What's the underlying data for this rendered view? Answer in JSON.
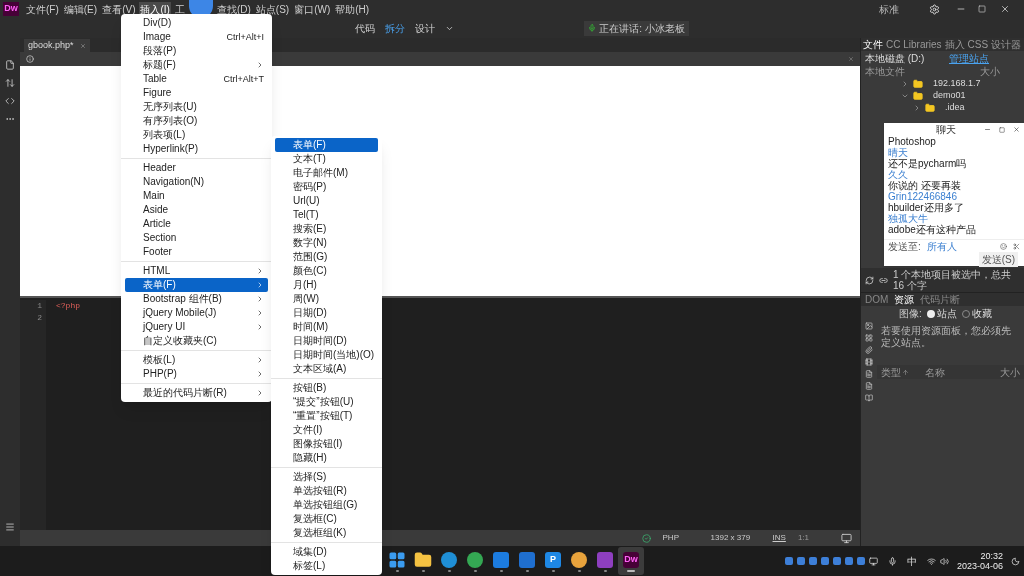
{
  "menu_bar": {
    "logo": "Dw",
    "items": [
      {
        "label": "文件(F)",
        "selected": false
      },
      {
        "label": "编辑(E)",
        "selected": false
      },
      {
        "label": "查看(V)",
        "selected": false
      },
      {
        "label": "插入(I)",
        "selected": true
      },
      {
        "label": "工",
        "selected": false
      },
      {
        "label": "查找(D)",
        "selected": false
      },
      {
        "label": "站点(S)",
        "selected": false
      },
      {
        "label": "窗口(W)",
        "selected": false
      },
      {
        "label": "帮助(H)",
        "selected": false
      }
    ]
  },
  "view_switch": [
    {
      "label": "代码",
      "selected": false
    },
    {
      "label": "拆分",
      "selected": true
    },
    {
      "label": "设计",
      "selected": false
    }
  ],
  "notification": "正在讲话: 小冰老板",
  "workspace": "标准",
  "document_tab": {
    "label": "gbook.php*"
  },
  "code_lines": [
    {
      "number": "1",
      "text": "<?php"
    },
    {
      "number": "2"
    }
  ],
  "status_bar": {
    "language": "PHP",
    "size": "1392 x 379",
    "mode": "INS",
    "position": "1:1"
  },
  "insert_menu": {
    "groups": [
      [
        {
          "label": "Div(D)",
          "submenu": false,
          "selected": false
        },
        {
          "label": "Image",
          "shortcut": "Ctrl+Alt+I",
          "submenu": false,
          "selected": false
        },
        {
          "label": "段落(P)",
          "submenu": false,
          "selected": false
        },
        {
          "label": "标题(F)",
          "submenu": true,
          "selected": false
        },
        {
          "label": "Table",
          "shortcut": "Ctrl+Alt+T",
          "submenu": false,
          "selected": false
        },
        {
          "label": "Figure",
          "submenu": false,
          "selected": false
        },
        {
          "label": "无序列表(U)",
          "submenu": false,
          "selected": false
        },
        {
          "label": "有序列表(O)",
          "submenu": false,
          "selected": false
        },
        {
          "label": "列表项(L)",
          "submenu": false,
          "selected": false
        },
        {
          "label": "Hyperlink(P)",
          "submenu": false,
          "selected": false
        }
      ],
      [
        {
          "label": "Header",
          "submenu": false,
          "selected": false
        },
        {
          "label": "Navigation(N)",
          "submenu": false,
          "selected": false
        },
        {
          "label": "Main",
          "submenu": false,
          "selected": false
        },
        {
          "label": "Aside",
          "submenu": false,
          "selected": false
        },
        {
          "label": "Article",
          "submenu": false,
          "selected": false
        },
        {
          "label": "Section",
          "submenu": false,
          "selected": false
        },
        {
          "label": "Footer",
          "submenu": false,
          "selected": false
        }
      ],
      [
        {
          "label": "HTML",
          "submenu": true,
          "selected": false
        },
        {
          "label": "表单(F)",
          "submenu": true,
          "selected": true
        },
        {
          "label": "Bootstrap 组件(B)",
          "submenu": true,
          "selected": false
        },
        {
          "label": "jQuery Mobile(J)",
          "submenu": true,
          "selected": false
        },
        {
          "label": "jQuery UI",
          "submenu": true,
          "selected": false
        },
        {
          "label": "自定义收藏夹(C)",
          "submenu": false,
          "selected": false
        }
      ],
      [
        {
          "label": "模板(L)",
          "submenu": true,
          "selected": false
        },
        {
          "label": "PHP(P)",
          "submenu": true,
          "selected": false
        }
      ],
      [
        {
          "label": "最近的代码片断(R)",
          "submenu": true,
          "selected": false
        }
      ]
    ]
  },
  "form_menu": {
    "groups": [
      [
        {
          "label": "表单(F)",
          "selected": true
        },
        {
          "label": "文本(T)",
          "selected": false
        },
        {
          "label": "电子邮件(M)",
          "selected": false
        },
        {
          "label": "密码(P)",
          "selected": false
        },
        {
          "label": "Url(U)",
          "selected": false
        },
        {
          "label": "Tel(T)",
          "selected": false
        },
        {
          "label": "搜索(E)",
          "selected": false
        },
        {
          "label": "数字(N)",
          "selected": false
        },
        {
          "label": "范围(G)",
          "selected": false
        },
        {
          "label": "颜色(C)",
          "selected": false
        },
        {
          "label": "月(H)",
          "selected": false
        },
        {
          "label": "周(W)",
          "selected": false
        },
        {
          "label": "日期(D)",
          "selected": false
        },
        {
          "label": "时间(M)",
          "selected": false
        },
        {
          "label": "日期时间(D)",
          "selected": false
        },
        {
          "label": "日期时间(当地)(O)",
          "selected": false
        },
        {
          "label": "文本区域(A)",
          "selected": false
        }
      ],
      [
        {
          "label": "按钮(B)",
          "selected": false
        },
        {
          "label": "“提交”按钮(U)",
          "selected": false
        },
        {
          "label": "“重置”按钮(T)",
          "selected": false
        },
        {
          "label": "文件(I)",
          "selected": false
        },
        {
          "label": "图像按钮(I)",
          "selected": false
        },
        {
          "label": "隐藏(H)",
          "selected": false
        }
      ],
      [
        {
          "label": "选择(S)",
          "selected": false
        },
        {
          "label": "单选按钮(R)",
          "selected": false
        },
        {
          "label": "单选按钮组(G)",
          "selected": false
        },
        {
          "label": "复选框(C)",
          "selected": false
        },
        {
          "label": "复选框组(K)",
          "selected": false
        }
      ],
      [
        {
          "label": "域集(D)",
          "selected": false
        },
        {
          "label": "标签(L)",
          "selected": false
        }
      ]
    ]
  },
  "files_panel": {
    "tabs": [
      {
        "label": "文件",
        "selected": true
      },
      {
        "label": "CC Libraries",
        "selected": false
      },
      {
        "label": "插入",
        "selected": false
      },
      {
        "label": "CSS 设计器",
        "selected": false
      }
    ],
    "drive": "本地磁盘 (D:)",
    "manage_link": "管理站点",
    "columns": [
      "本地文件",
      "大小"
    ],
    "tree": [
      {
        "label": "192.168.1.7",
        "expanded": false
      },
      {
        "label": "demo01",
        "expanded": true,
        "children": [
          {
            "label": ".idea",
            "expanded": false
          }
        ]
      }
    ],
    "status": "1 个本地项目被选中，总共 16 个字"
  },
  "chat_window": {
    "title": "聊天",
    "messages": [
      {
        "text": "Photoshop",
        "kind": "message"
      },
      {
        "text": "晴天",
        "kind": "name"
      },
      {
        "text": "还不是pycharm吗",
        "kind": "message"
      },
      {
        "text": "久久",
        "kind": "name"
      },
      {
        "text": "你说的 还要再装",
        "kind": "message"
      },
      {
        "text": "Grin122466846",
        "kind": "name"
      },
      {
        "text": "hbuilder还用多了",
        "kind": "message"
      },
      {
        "text": "独孤大牛",
        "kind": "name"
      },
      {
        "text": "adobe还有这种产品",
        "kind": "message"
      }
    ],
    "send_to_label": "发送至:",
    "recipient": "所有人",
    "send_button": "发送(S)"
  },
  "assets_panel": {
    "tabs": [
      {
        "label": "DOM",
        "selected": false
      },
      {
        "label": "资源",
        "selected": true
      },
      {
        "label": "代码片断",
        "selected": false
      }
    ],
    "filter_label": "图像:",
    "filters": [
      {
        "label": "站点",
        "selected": true
      },
      {
        "label": "收藏",
        "selected": false
      }
    ],
    "message": "若要使用资源面板，您必须先定义站点。",
    "columns": [
      "类型",
      "名称",
      "大小"
    ]
  },
  "taskbar": {
    "apps": [
      {
        "kind": "start",
        "color": "#3b9cf0",
        "selected": false
      },
      {
        "kind": "folder",
        "color": "#f5c242",
        "selected": false
      },
      {
        "kind": "round",
        "color": "#1f8fd6",
        "selected": false
      },
      {
        "kind": "round",
        "color": "#34a853",
        "selected": false
      },
      {
        "kind": "tile",
        "color": "#1c7ce0",
        "selected": false
      },
      {
        "kind": "tile",
        "color": "#1f6fd0",
        "selected": false
      },
      {
        "kind": "letter",
        "label": "P",
        "color": "#1e88e5",
        "selected": false
      },
      {
        "kind": "round",
        "color": "#e8a33c",
        "selected": false
      },
      {
        "kind": "tile",
        "color": "#8e3fbf",
        "selected": false
      },
      {
        "kind": "letter",
        "label": "Dw",
        "color": "#470137",
        "selected": true
      }
    ],
    "ime": "中",
    "time": "20:32",
    "date": "2023-04-06"
  }
}
